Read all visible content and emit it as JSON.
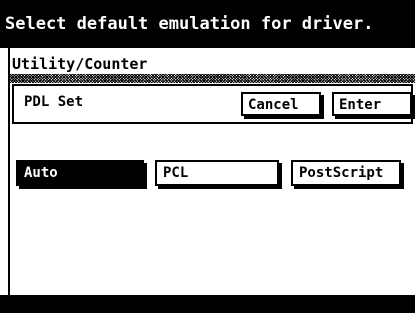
{
  "header": {
    "message": "Select default emulation for driver."
  },
  "breadcrumb": "Utility/Counter",
  "panel": {
    "title": "PDL Set",
    "cancel_label": "Cancel",
    "enter_label": "Enter"
  },
  "options": {
    "auto": "Auto",
    "pcl": "PCL",
    "postscript": "PostScript",
    "selected": "Auto"
  }
}
